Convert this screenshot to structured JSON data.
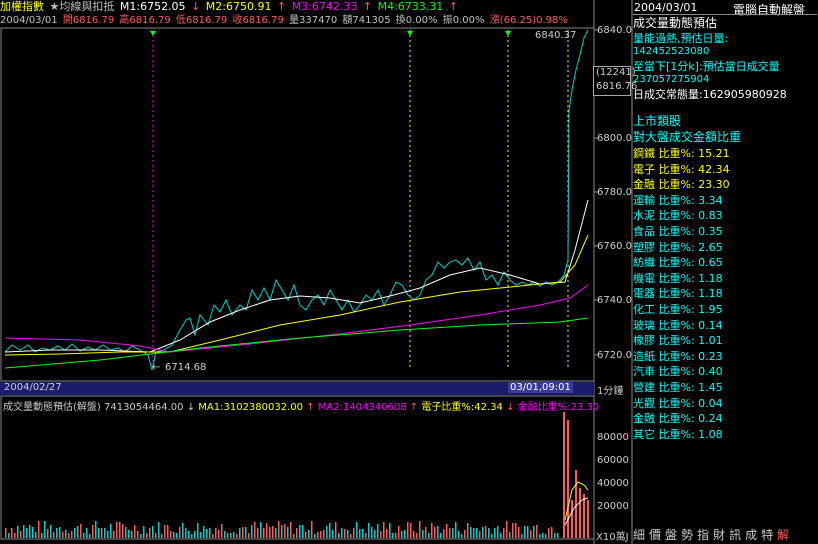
{
  "header": {
    "title": "加權指數",
    "indicator_label": "★均線與扣抵",
    "m1": "M1:6752.05",
    "m2": "M2:6750.91",
    "m3": "M3:6742.33",
    "m4": "M4:6733.31"
  },
  "stats": {
    "date": "2004/03/01",
    "open": "開6816.79",
    "high": "高6816.79",
    "low": "低6816.79",
    "close": "收6816.79",
    "volume": "量337470",
    "amount": "額741305",
    "turnover": "換0.00%",
    "amplitude": "振0.00%",
    "change": "漲(66.25)0.98%"
  },
  "price_chart": {
    "y_ticks": [
      "6840.0",
      "6800.0",
      "6780.0",
      "6760.0",
      "6740.0",
      "6720.0"
    ],
    "high_label": "6840.37",
    "low_label": "6714.68",
    "cursor_value": "12241",
    "cursor_price": "6816.76",
    "date_left": "2004/02/27",
    "date_right": "03/01,09:01",
    "period": "1分鐘"
  },
  "volume_chart": {
    "title": "成交量動態預估(解盤) 7413054464.00",
    "ma1": "MA1:3102380032.00",
    "ma2": "MA2:1404340608",
    "elec": "電子比重%:42.34",
    "fin": "金融比重%:23.30",
    "y_ticks": [
      "80000",
      "60000",
      "40000",
      "20000"
    ],
    "unit": "X10萬",
    "unit_suffix": "J"
  },
  "right_panel": {
    "date": "2004/03/01",
    "header_title": "電腦自動解盤",
    "section_title": "成交量動態預估",
    "overheat_label": "量能過熱,預估日量:",
    "overheat_value": "142452523080",
    "minute_label": "至當下[1分k]:預估當日成交量",
    "minute_value": "237057275904",
    "daily_label": "日成交常態量:162905980928",
    "sector_title": "上市類股",
    "ratio_title": "對大盤成交金額比重",
    "sectors": [
      {
        "name": "鋼鐵",
        "value": "比重%: 15.21"
      },
      {
        "name": "電子",
        "value": "比重%: 42.34"
      },
      {
        "name": "金融",
        "value": "比重%: 23.30"
      },
      {
        "name": "運輸",
        "value": "比重%: 3.34"
      },
      {
        "name": "水泥",
        "value": "比重%: 0.83"
      },
      {
        "name": "食品",
        "value": "比重%: 0.35"
      },
      {
        "name": "塑膠",
        "value": "比重%: 2.65"
      },
      {
        "name": "紡織",
        "value": "比重%: 0.65"
      },
      {
        "name": "機電",
        "value": "比重%: 1.18"
      },
      {
        "name": "電器",
        "value": "比重%: 1.18"
      },
      {
        "name": "化工",
        "value": "比重%: 1.95"
      },
      {
        "name": "玻璃",
        "value": "比重%: 0.14"
      },
      {
        "name": "橡膠",
        "value": "比重%: 1.01"
      },
      {
        "name": "造紙",
        "value": "比重%: 0.23"
      },
      {
        "name": "汽車",
        "value": "比重%: 0.40"
      },
      {
        "name": "營建",
        "value": "比重%: 1.45"
      },
      {
        "name": "光觀",
        "value": "比重%: 0.04"
      },
      {
        "name": "金融",
        "value": "比重%: 0.24"
      },
      {
        "name": "其它",
        "value": "比重%: 1.08"
      }
    ]
  },
  "bottom_menu": [
    "細",
    "價",
    "盤",
    "勢",
    "指",
    "財",
    "訊",
    "成",
    "特",
    "解"
  ],
  "colors": {
    "yellow": "#ffff00",
    "red": "#ff5a5a",
    "green": "#00ff00",
    "cyan": "#00ffff",
    "magenta": "#ff00ff",
    "white": "#ffffff",
    "grey": "#c0c0c0"
  }
}
